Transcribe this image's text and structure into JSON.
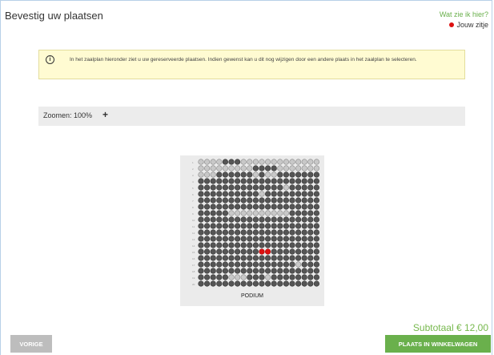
{
  "header": {
    "title": "Bevestig uw plaatsen",
    "help_link": "Wat zie ik hier?",
    "legend_label": "Jouw zitje"
  },
  "info": {
    "text": "In het zaalplan hieronder ziet u uw gereserveerde plaatsen. Indien gewenst kan u dit nog wijzigen door een andere plaats in het zaalplan te selecteren."
  },
  "zoom": {
    "label": "Zoomen: 100%",
    "plus": "+"
  },
  "seatplan": {
    "stage_label": "PODIUM",
    "legend": {
      "occupied": "#555555",
      "free": "#c8c8c8",
      "mine": "#dd1111"
    },
    "rows": [
      "oooo###ooooooooooooo",
      "ooooooooo####ooooooo",
      "ooo######o#oo#######",
      "####################",
      "##############o#####",
      "##########o#########",
      "####################",
      "####################",
      "#####oooooooooo#####",
      "####################",
      "####################",
      "####################",
      "####################",
      "####################",
      "##########**########",
      "####################",
      "################o###",
      "####################",
      "#####ooo###o########",
      "####################"
    ]
  },
  "footer": {
    "prev_label": "VORIGE",
    "subtotal": "Subtotaal € 12,00",
    "cart_label": "PLAATS IN WINKELWAGEN"
  }
}
